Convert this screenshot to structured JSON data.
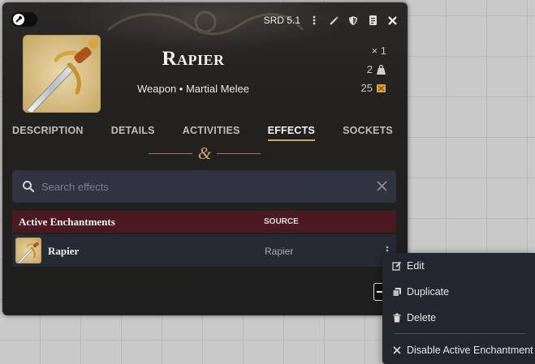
{
  "toolbar": {
    "source": "SRD 5.1",
    "icons": [
      "ellipsis-vertical-icon",
      "magic-wand-icon",
      "shield-icon",
      "scroll-icon",
      "close-icon"
    ]
  },
  "item": {
    "name": "Rapier",
    "subtitle": "Weapon • Martial Melee",
    "quantity": "× 1",
    "weight": "2",
    "price": "25"
  },
  "tabs": [
    {
      "label": "DESCRIPTION",
      "active": false
    },
    {
      "label": "DETAILS",
      "active": false
    },
    {
      "label": "ACTIVITIES",
      "active": false
    },
    {
      "label": "EFFECTS",
      "active": true
    },
    {
      "label": "SOCKETS",
      "active": false
    }
  ],
  "divider_glyph": "&",
  "search": {
    "placeholder": "Search effects",
    "value": ""
  },
  "section": {
    "title": "Active Enchantments",
    "source_header": "SOURCE"
  },
  "effects": [
    {
      "name": "Rapier",
      "source": "Rapier"
    }
  ],
  "context_menu": {
    "items": [
      {
        "label": "Edit",
        "icon": "edit-icon"
      },
      {
        "label": "Duplicate",
        "icon": "copy-icon"
      },
      {
        "label": "Delete",
        "icon": "trash-icon"
      },
      {
        "label": "Disable Active Enchantment",
        "icon": "close-icon"
      }
    ]
  },
  "colors": {
    "accent": "#c9a66b",
    "section_header": "#4a1a20",
    "panel": "#1e1e1e"
  }
}
